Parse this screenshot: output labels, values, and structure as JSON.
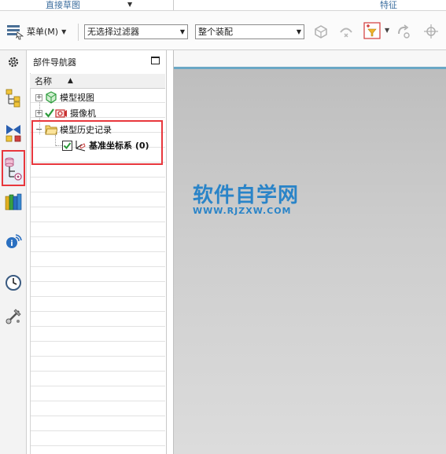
{
  "ribbon": {
    "groups": [
      {
        "label": "直接草图"
      },
      {
        "label": "特征"
      }
    ]
  },
  "toolbar": {
    "menu_label": "菜单(M)",
    "filter_select": "无选择过滤器",
    "scope_select": "整个装配"
  },
  "navigator": {
    "title": "部件导航器",
    "column_name": "名称",
    "items": [
      {
        "label": "模型视图",
        "expander": "+"
      },
      {
        "label": "摄像机",
        "expander": "+"
      },
      {
        "label": "模型历史记录",
        "expander": "−"
      },
      {
        "label": "基准坐标系 (0)"
      }
    ]
  },
  "watermark": {
    "title": "软件自学网",
    "url": "WWW.RJZXW.COM"
  },
  "colors": {
    "accent": "#2a84c8",
    "highlight": "#e8373d",
    "viewport_top": "#6aa7c5"
  },
  "icons": {
    "rail": [
      "gear-icon",
      "assembly-navigator-icon",
      "constraint-navigator-icon",
      "part-navigator-icon",
      "reuse-library-icon",
      "info-icon",
      "history-icon",
      "process-studio-icon"
    ]
  }
}
